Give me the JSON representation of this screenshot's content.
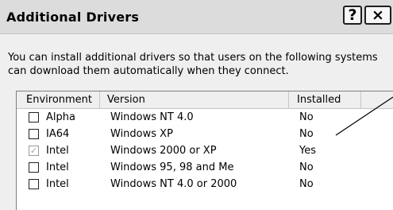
{
  "window": {
    "title": "Additional Drivers",
    "help_label": "?",
    "close_label": "×"
  },
  "description": "You can install additional drivers so that users on the following systems can download them automatically when they connect.",
  "list": {
    "columns": [
      "Environment",
      "Version",
      "Installed"
    ],
    "rows": [
      {
        "environment": "Alpha",
        "version": "Windows NT 4.0",
        "installed": "No",
        "checked": false
      },
      {
        "environment": "IA64",
        "version": "Windows XP",
        "installed": "No",
        "checked": false
      },
      {
        "environment": "Intel",
        "version": "Windows 2000 or XP",
        "installed": "Yes",
        "checked": true
      },
      {
        "environment": "Intel",
        "version": "Windows 95, 98 and Me",
        "installed": "No",
        "checked": false
      },
      {
        "environment": "Intel",
        "version": "Windows NT 4.0 or 2000",
        "installed": "No",
        "checked": false
      }
    ]
  }
}
